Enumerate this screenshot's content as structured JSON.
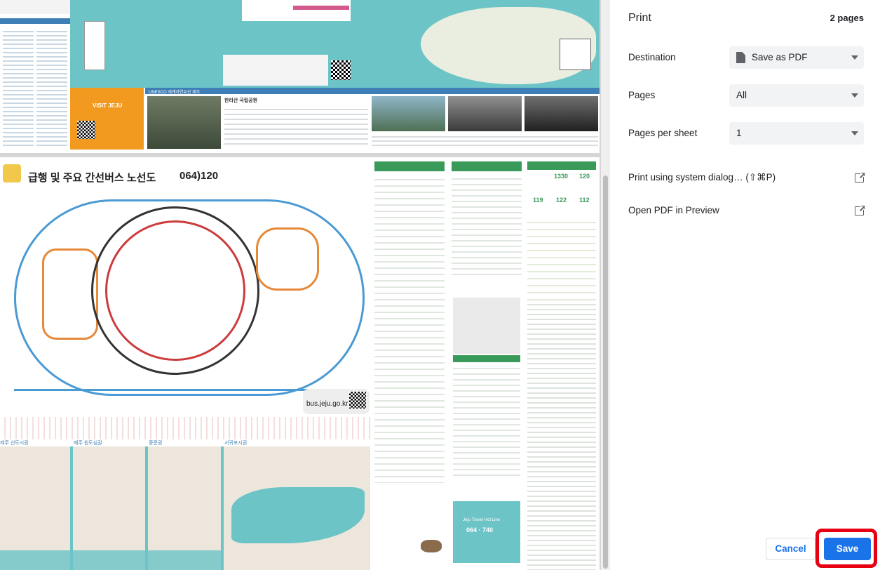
{
  "dialog": {
    "title": "Print",
    "page_count": "2 pages",
    "destination": {
      "label": "Destination",
      "value": "Save as PDF"
    },
    "pages": {
      "label": "Pages",
      "value": "All"
    },
    "pages_per_sheet": {
      "label": "Pages per sheet",
      "value": "1"
    },
    "system_dialog_link": "Print using system dialog… (⇧⌘P)",
    "open_preview_link": "Open PDF in Preview",
    "cancel_label": "Cancel",
    "save_label": "Save"
  },
  "preview": {
    "bus_map_title": "급행 및 주요 간선버스 노선도",
    "bus_map_phone": "064)120",
    "bus_site": "bus.jeju.go.kr",
    "visit_jeju": "VISIT JEJU",
    "unesco_heading": "UNESCO 세계자연유산 제주",
    "hallasan_heading": "한라산 국립공원",
    "hotline_heading": "Jeju Travel Hot Line",
    "hotline_number": "064 · 740",
    "jeju_city_label": "제주 신도시권",
    "jeju_old_label": "제주 원도심권",
    "jungmun_label": "중문권",
    "seogwipo_label": "서귀포시권",
    "bus_num_1": "1330",
    "bus_num_2": "120",
    "bus_num_3": "119",
    "bus_num_4": "122",
    "bus_num_5": "112"
  },
  "colors": {
    "accent": "#1a73e8",
    "highlight": "#e60012",
    "map_teal": "#6cc4c7",
    "guide_green": "#3a9a5a",
    "visit_orange": "#f29a1f"
  }
}
